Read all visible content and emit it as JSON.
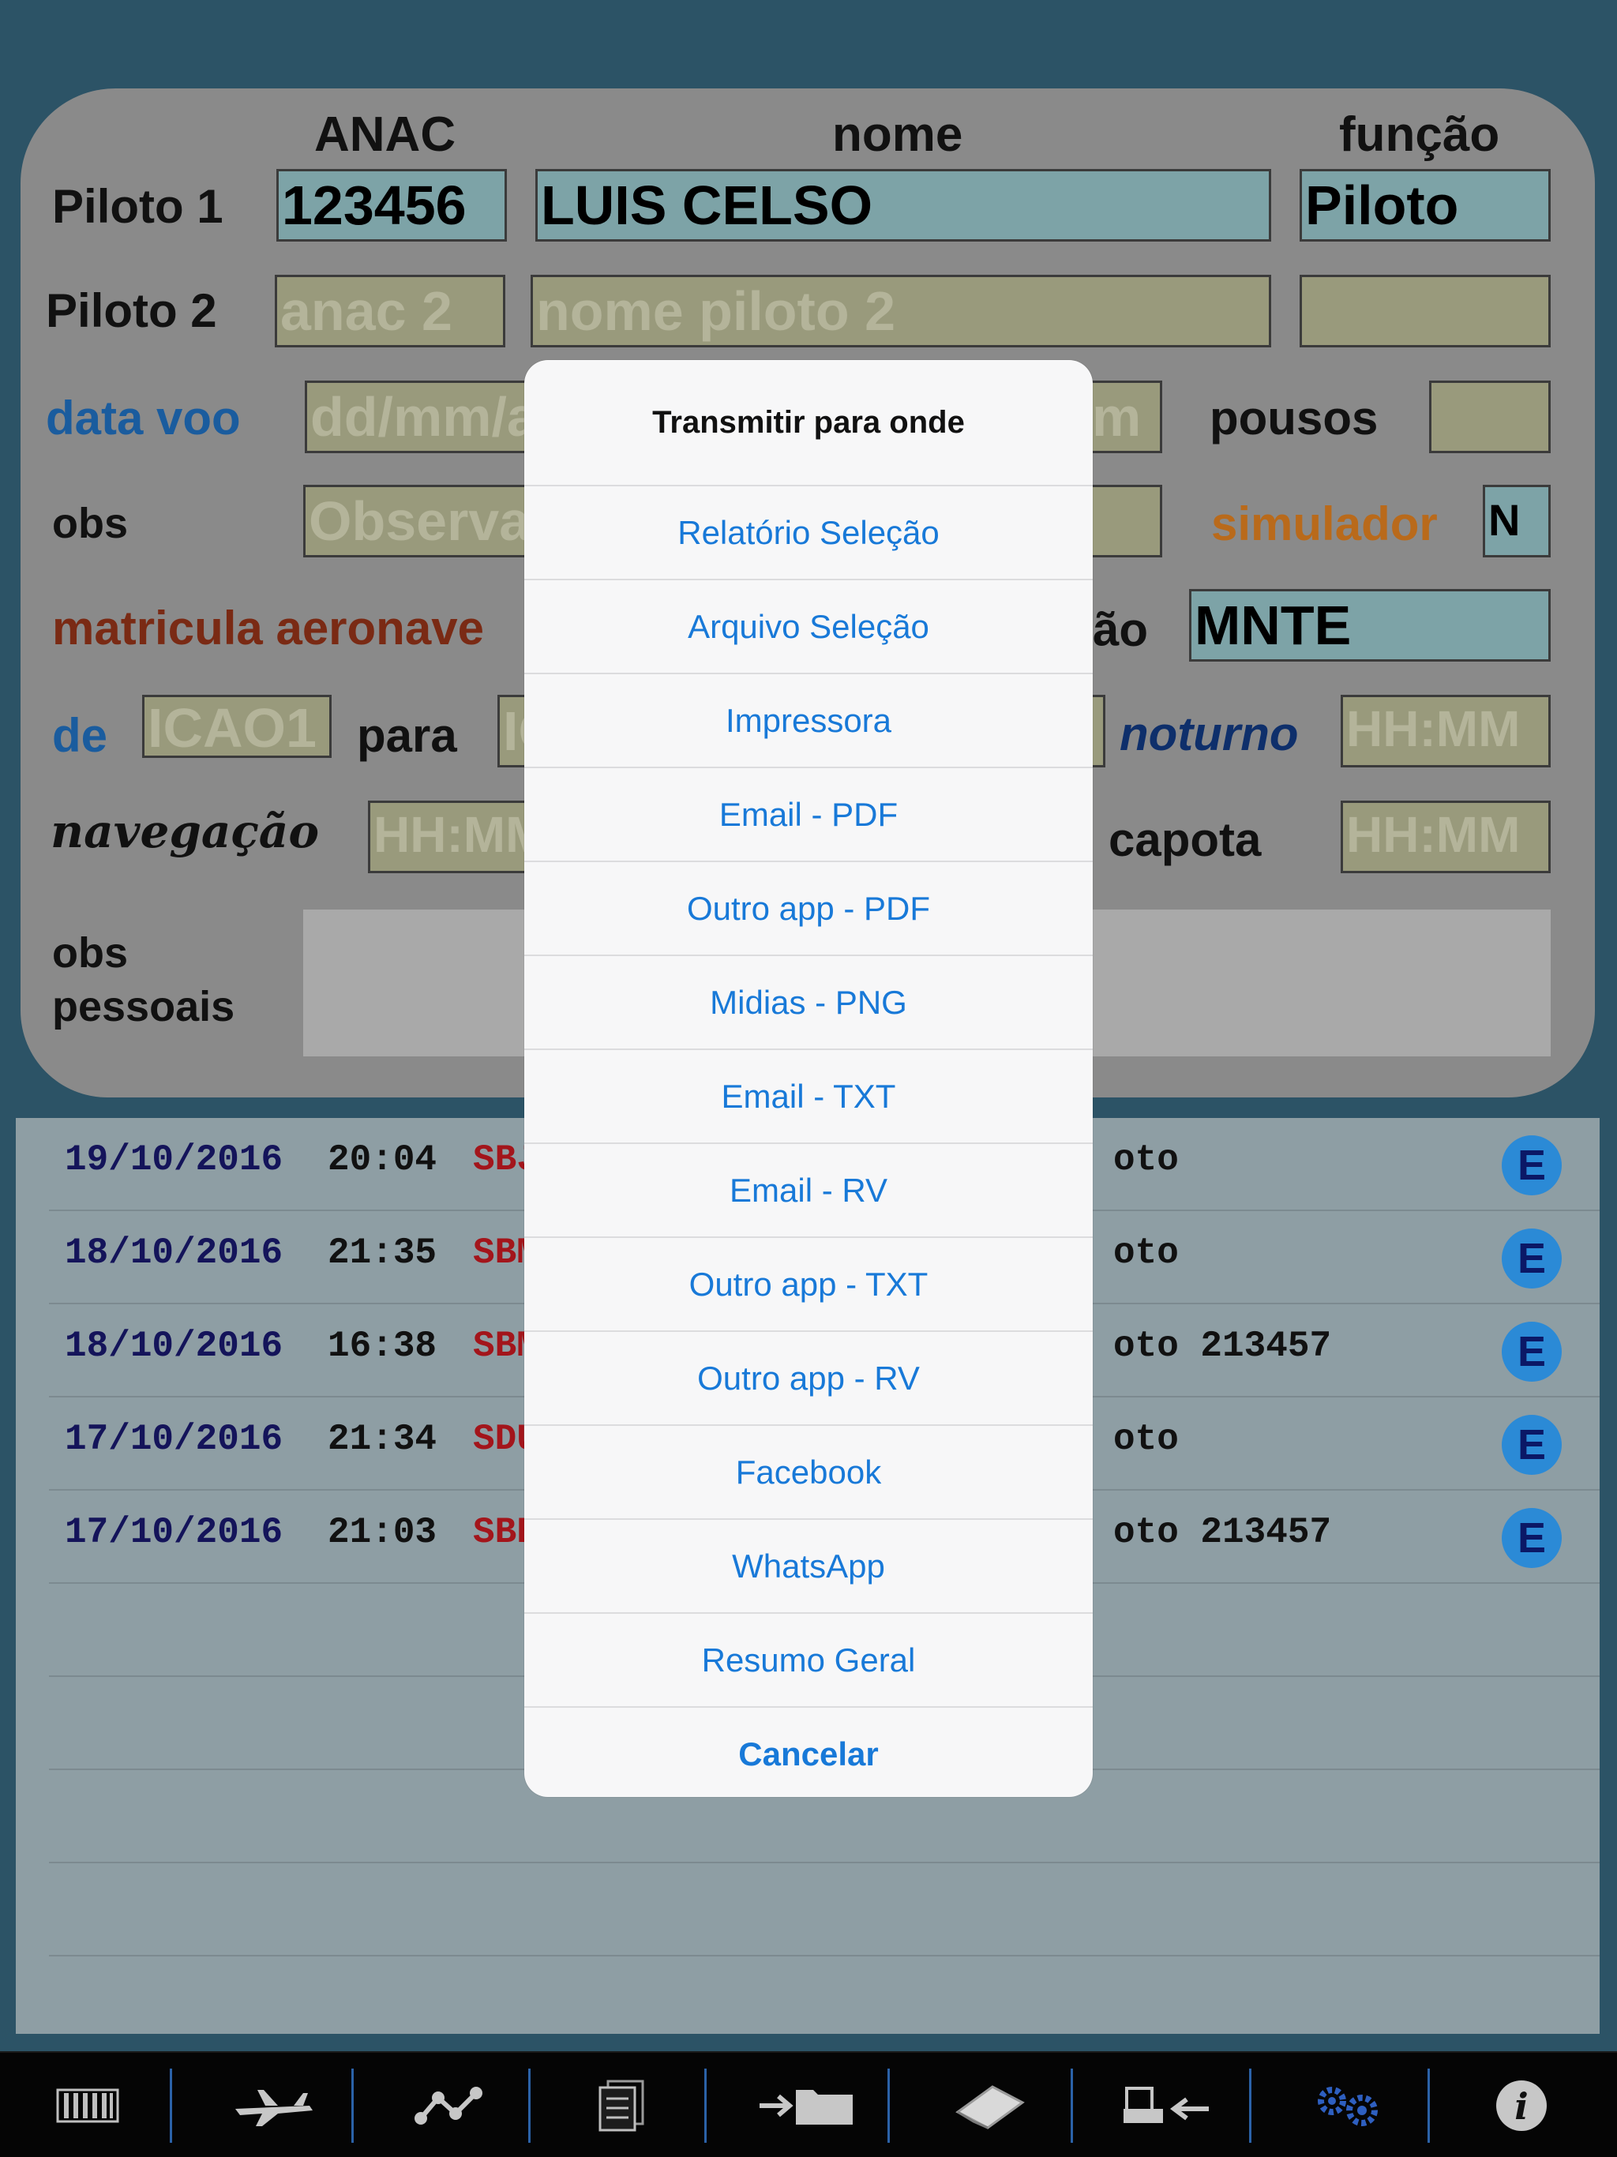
{
  "form": {
    "headers": {
      "anac": "ANAC",
      "nome": "nome",
      "funcao": "função"
    },
    "piloto1": {
      "label": "Piloto 1",
      "anac": "123456",
      "nome": "LUIS CELSO",
      "funcao": "Piloto"
    },
    "piloto2": {
      "label": "Piloto 2",
      "anac_placeholder": "anac 2",
      "nome_placeholder": "nome piloto 2",
      "funcao": ""
    },
    "data_voo": {
      "label": "data voo",
      "placeholder": "dd/mm/a",
      "hidden_tail": "m"
    },
    "pousos": {
      "label": "pousos",
      "value": ""
    },
    "obs": {
      "label": "obs",
      "placeholder": "Observaç"
    },
    "simulador": {
      "label": "simulador",
      "value": "N"
    },
    "matricula": {
      "label": "matricula aeronave",
      "tail_label": "ão",
      "value": "MNTE"
    },
    "de": {
      "label": "de",
      "placeholder": "ICAO1"
    },
    "para": {
      "label": "para",
      "placeholder": "IC"
    },
    "noturno": {
      "label": "noturno",
      "placeholder": "HH:MM"
    },
    "navegacao": {
      "label": "navegação",
      "placeholder": "HH:MM"
    },
    "capota": {
      "label": "capota",
      "placeholder": "HH:MM"
    },
    "obs_pessoais": {
      "label_line1": "obs",
      "label_line2": "pessoais"
    }
  },
  "flights": [
    {
      "date": "19/10/2016",
      "time": "20:04",
      "origin": "SBJ",
      "rest": "oto",
      "action": "E"
    },
    {
      "date": "18/10/2016",
      "time": "21:35",
      "origin": "SBM",
      "rest": "oto",
      "action": "E"
    },
    {
      "date": "18/10/2016",
      "time": "16:38",
      "origin": "SBM",
      "rest": "oto 213457",
      "action": "E"
    },
    {
      "date": "17/10/2016",
      "time": "21:34",
      "origin": "SDU",
      "rest": "oto",
      "action": "E"
    },
    {
      "date": "17/10/2016",
      "time": "21:03",
      "origin": "SBB",
      "rest": "oto 213457",
      "action": "E"
    }
  ],
  "sheet": {
    "title": "Transmitir para onde",
    "options": [
      "Relatório Seleção",
      "Arquivo Seleção",
      "Impressora",
      "Email - PDF",
      "Outro app - PDF",
      "Midias - PNG",
      "Email - TXT",
      "Email - RV",
      "Outro app - TXT",
      "Outro app - RV",
      "Facebook",
      "WhatsApp",
      "Resumo Geral"
    ],
    "cancel": "Cancelar"
  },
  "toolbar": {
    "icons": [
      "barcode-icon",
      "airplane-icon",
      "route-icon",
      "documents-icon",
      "folder-import-icon",
      "eraser-icon",
      "printer-import-icon",
      "settings-icon",
      "info-icon"
    ]
  },
  "colors": {
    "background": "#2c5366",
    "panel": "#8a8a8a",
    "field_filled": "#7da3a7",
    "field_empty": "#999a7c",
    "accent_blue": "#1879d8",
    "e_button": "#2b8ad6"
  }
}
